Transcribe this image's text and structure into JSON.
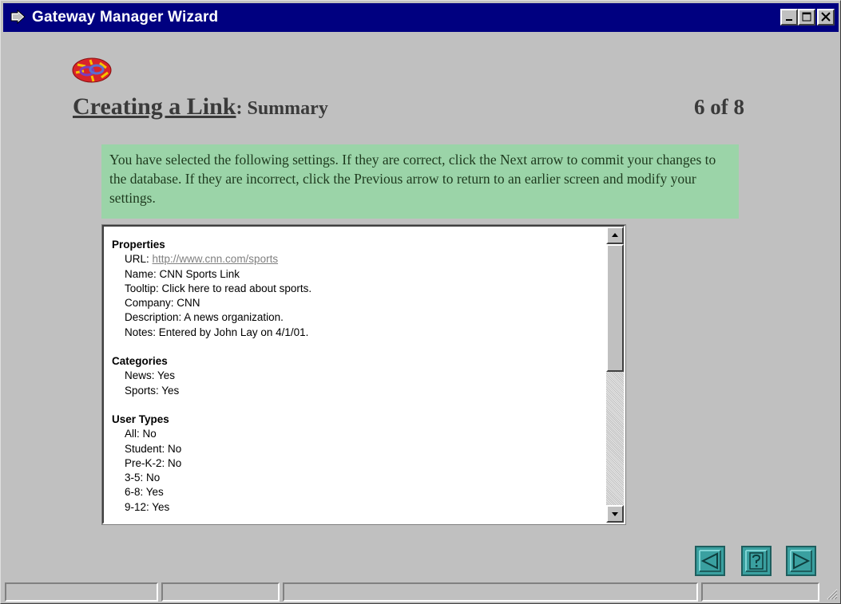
{
  "window": {
    "title": "Gateway Manager Wizard",
    "icons": {
      "app": "wizard-arrow-icon",
      "minimize": "minimize-icon",
      "maximize": "maximize-icon",
      "close": "close-icon"
    }
  },
  "header": {
    "logo_icon": "chain-link-logo-icon",
    "title": "Creating a Link",
    "separator": ":",
    "subtitle": "Summary",
    "page": "6 of 8"
  },
  "instructions": "You have selected the following settings. If they are correct, click the Next arrow to commit your changes to the database. If they are incorrect, click the Previous arrow to return to an earlier screen and modify your settings.",
  "summary": {
    "properties": {
      "title": "Properties",
      "url_label": "URL: ",
      "url_value": "http://www.cnn.com/sports",
      "name": "Name: CNN Sports Link",
      "tooltip": "Tooltip:  Click here to read about sports.",
      "company": "Company: CNN",
      "description": "Description: A news organization.",
      "notes": "Notes: Entered by John Lay on 4/1/01."
    },
    "categories": {
      "title": "Categories",
      "items": [
        "News: Yes",
        "Sports: Yes"
      ]
    },
    "user_types": {
      "title": "User Types",
      "items": [
        "All: No",
        "Student: No",
        "Pre-K-2: No",
        "3-5: No",
        "6-8: Yes",
        "9-12: Yes"
      ]
    }
  },
  "navigation": {
    "previous_icon": "previous-arrow-icon",
    "help_icon": "help-question-icon",
    "next_icon": "next-arrow-icon"
  },
  "colors": {
    "titlebar": "#000080",
    "instructions_bg": "#9bd4a8",
    "nav_button": "#3aa0a0",
    "window_bg": "#c0c0c0"
  }
}
